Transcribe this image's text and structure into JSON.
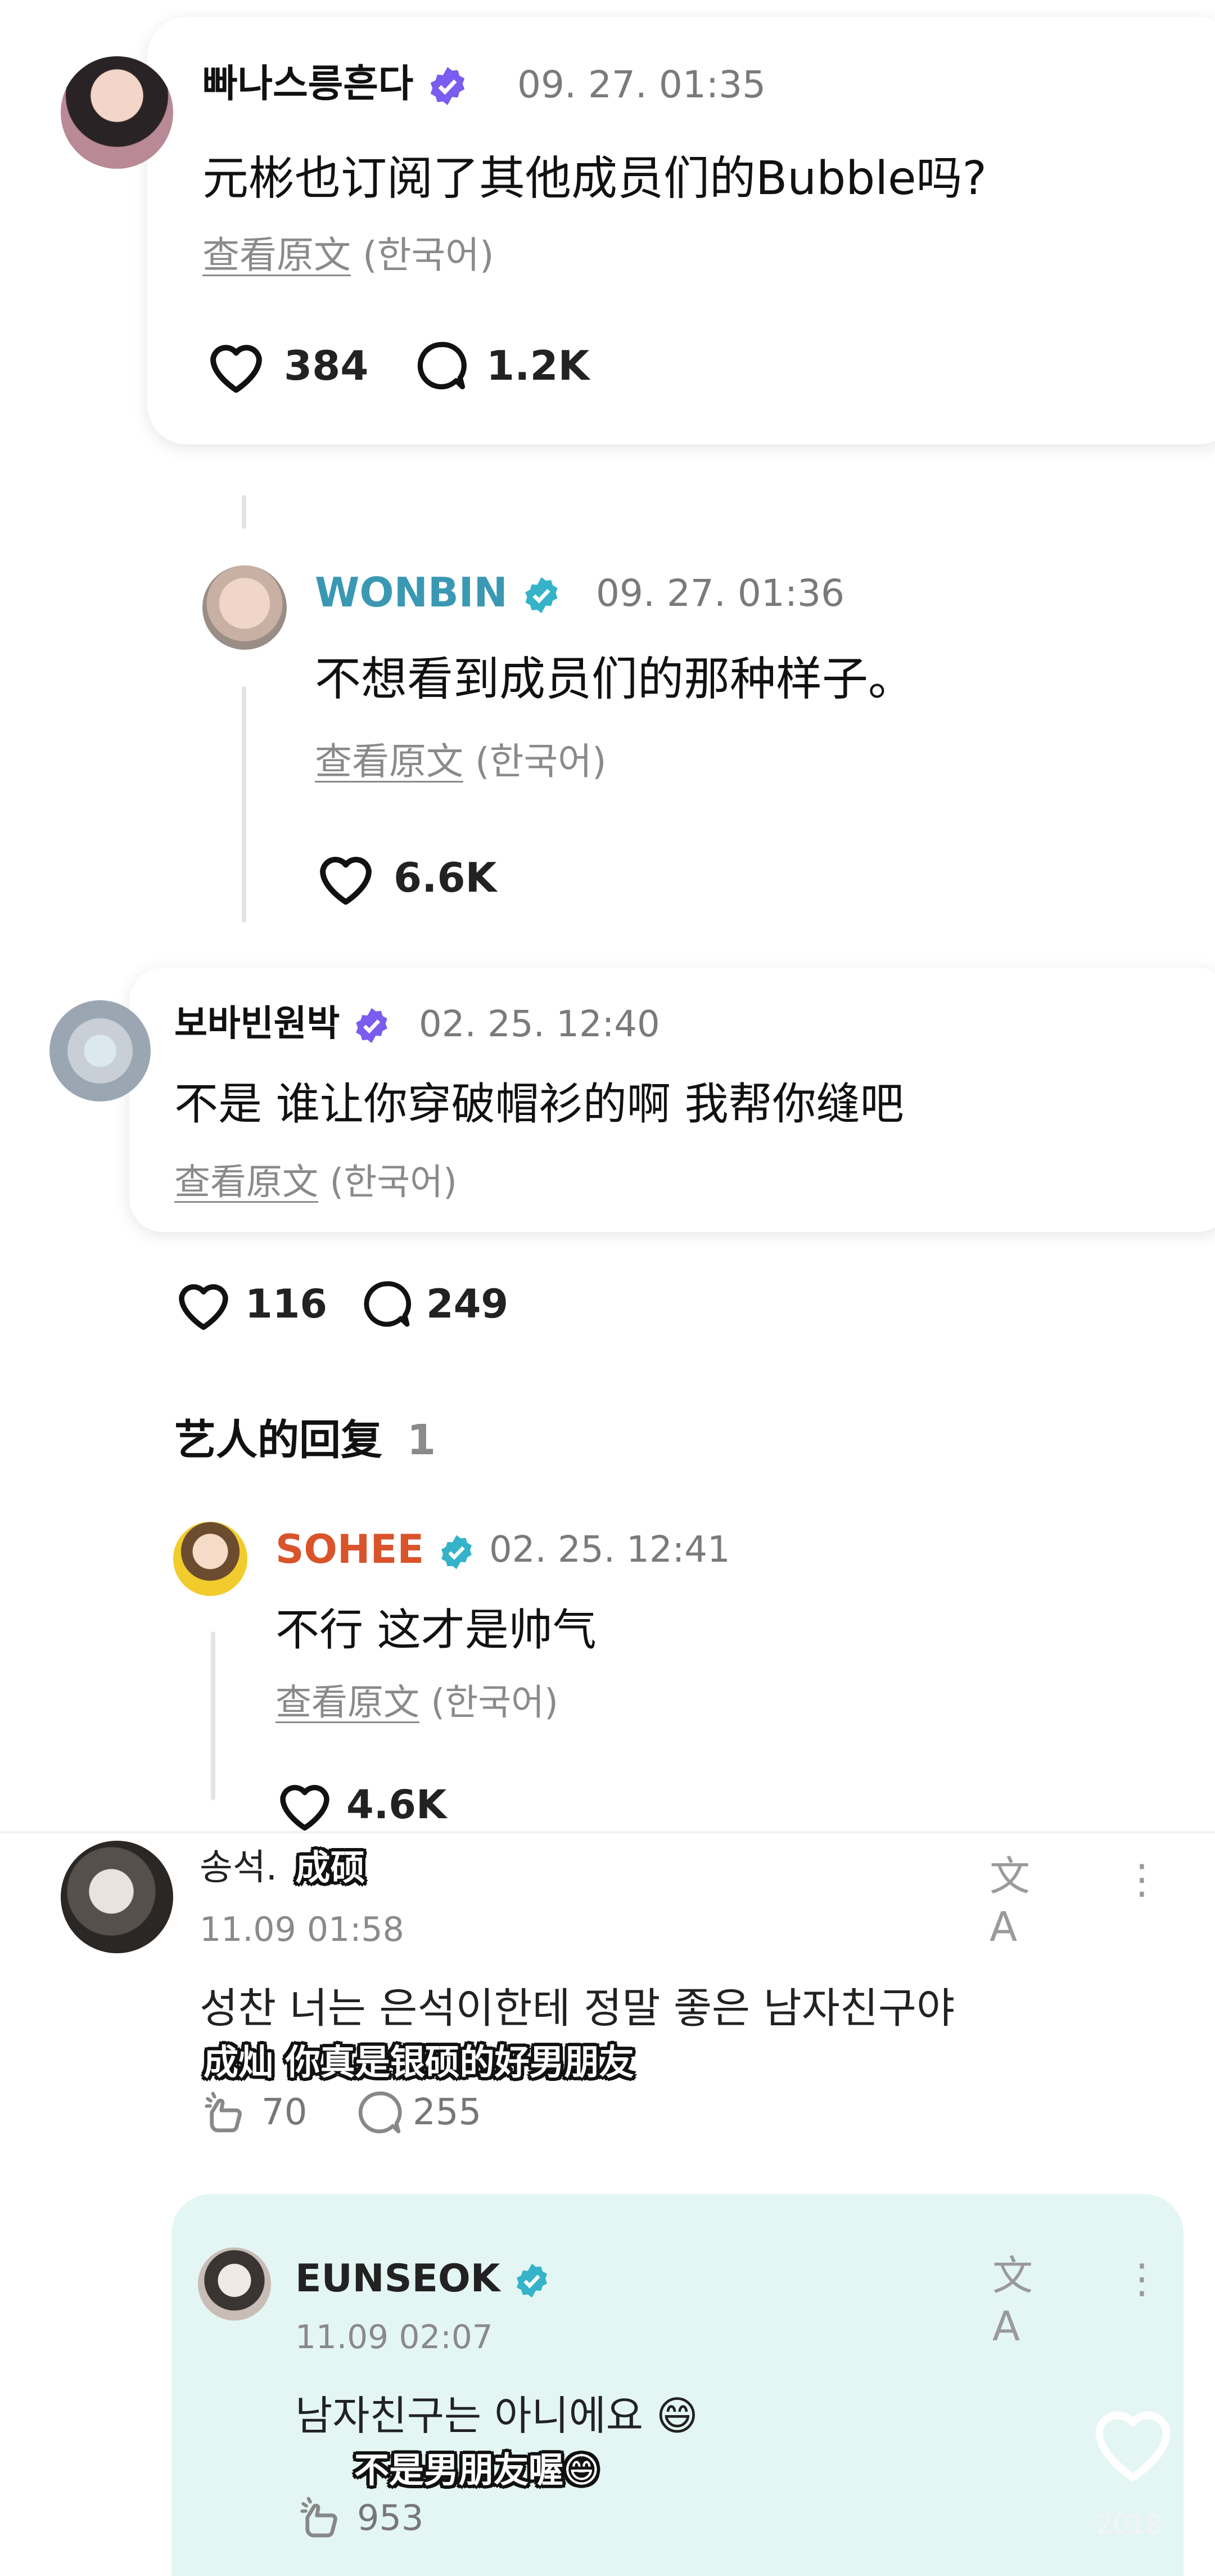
{
  "section1": {
    "post": {
      "author": "빠나스릉흔다",
      "time": "09. 27. 01:35",
      "text": "元彬也订阅了其他成员们的Bubble吗?",
      "original_label": "查看原文",
      "original_lang": "(한국어)",
      "likes": "384",
      "comments": "1.2K"
    },
    "reply": {
      "author": "WONBIN",
      "author_color": "#3a98b3",
      "time": "09. 27. 01:36",
      "text": "不想看到成员们的那种样子。",
      "original_label": "查看原文",
      "original_lang": "(한국어)",
      "likes": "6.6K"
    }
  },
  "section2": {
    "post": {
      "author": "보바빈원박",
      "time": "02. 25. 12:40",
      "text": "不是 谁让你穿破帽衫的啊 我帮你缝吧",
      "original_label": "查看原文",
      "original_lang": "(한국어)",
      "likes": "116",
      "comments": "249"
    },
    "artist_replies_label": "艺人的回复",
    "artist_replies_count": "1",
    "reply": {
      "author": "SOHEE",
      "author_color": "#d9542b",
      "time": "02. 25. 12:41",
      "text": "不行 这才是帅气",
      "original_label": "查看原文",
      "original_lang": "(한국어)",
      "likes": "4.6K"
    }
  },
  "section3": {
    "post": {
      "author": "송석.",
      "author_caption": "成硕",
      "time": "11.09 01:58",
      "text": "성찬 너는 은석이한테 정말 좋은 남자친구야",
      "caption": "成灿 你真是银硕的好男朋友",
      "likes": "70",
      "comments": "255"
    },
    "reply": {
      "author": "EUNSEOK",
      "time": "11.09 02:07",
      "text": "남자친구는 아니에요 😄",
      "caption": "不是男朋友喔😄",
      "likes": "953",
      "background": "#e4f6f3"
    }
  },
  "watermark": "2018"
}
